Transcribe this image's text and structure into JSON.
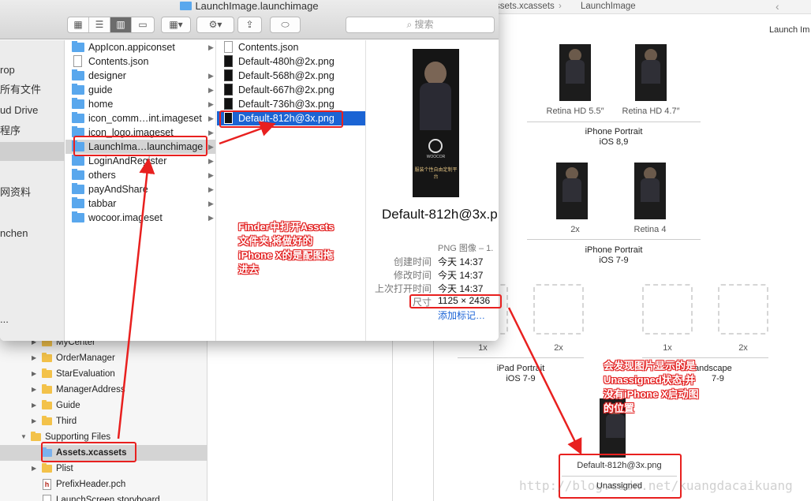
{
  "xcode": {
    "jump_bar": [
      "ssets.xcassets",
      "LaunchImage"
    ],
    "section_label": "Launch Im",
    "navigator_rows": [
      {
        "label": "MyCenter",
        "kind": "folder",
        "indent": 1,
        "open": false
      },
      {
        "label": "OrderManager",
        "kind": "folder",
        "indent": 1,
        "open": false
      },
      {
        "label": "StarEvaluation",
        "kind": "folder",
        "indent": 1,
        "open": false
      },
      {
        "label": "ManagerAddress",
        "kind": "folder",
        "indent": 1,
        "open": false
      },
      {
        "label": "Guide",
        "kind": "folder",
        "indent": 1,
        "open": false
      },
      {
        "label": "Third",
        "kind": "folder",
        "indent": 1,
        "open": false
      },
      {
        "label": "Supporting Files",
        "kind": "folder",
        "indent": 0,
        "open": true
      },
      {
        "label": "Assets.xcassets",
        "kind": "assets",
        "indent": 1,
        "open": false
      },
      {
        "label": "Plist",
        "kind": "folder",
        "indent": 1,
        "open": false
      },
      {
        "label": "PrefixHeader.pch",
        "kind": "header",
        "indent": 1,
        "open": false
      },
      {
        "label": "LaunchScreen.storyboard",
        "kind": "storyboard",
        "indent": 1,
        "open": false
      }
    ],
    "slots": {
      "retina55": "Retina HD 5.5″",
      "retina47": "Retina HD 4.7″",
      "iphone_portrait_89": [
        "iPhone Portrait",
        "iOS 8,9"
      ],
      "x2": "2x",
      "retina4": "Retina 4",
      "iphone_portrait_79": [
        "iPhone Portrait",
        "iOS 7-9"
      ],
      "x1": "1x",
      "ipad_portrait": [
        "iPad Portrait",
        "iOS 7-9"
      ],
      "ipad_landscape": [
        "andscape",
        "7-9"
      ],
      "unassigned_file": "Default-812h@3x.png",
      "unassigned_label": "Unassigned"
    }
  },
  "finder": {
    "title": "LaunchImage.launchimage",
    "search_placeholder": "搜索",
    "sidebar": [
      "rop",
      "所有文件",
      "ud Drive",
      "程序",
      "",
      "网资料",
      "",
      "nchen",
      "",
      "..."
    ],
    "col1": [
      {
        "name": "AppIcon.appiconset",
        "folder": true,
        "arrow": true
      },
      {
        "name": "Contents.json",
        "folder": false,
        "arrow": false
      },
      {
        "name": "designer",
        "folder": true,
        "arrow": true
      },
      {
        "name": "guide",
        "folder": true,
        "arrow": true
      },
      {
        "name": "home",
        "folder": true,
        "arrow": true
      },
      {
        "name": "icon_comm…int.imageset",
        "folder": true,
        "arrow": true
      },
      {
        "name": "icon_logo.imageset",
        "folder": true,
        "arrow": true
      },
      {
        "name": "LaunchIma…launchimage",
        "folder": true,
        "arrow": true,
        "selected": true
      },
      {
        "name": "LoginAndRegister",
        "folder": true,
        "arrow": true
      },
      {
        "name": "others",
        "folder": true,
        "arrow": true
      },
      {
        "name": "payAndShare",
        "folder": true,
        "arrow": true
      },
      {
        "name": "tabbar",
        "folder": true,
        "arrow": true
      },
      {
        "name": "wocoor.imageset",
        "folder": true,
        "arrow": true
      }
    ],
    "col2": [
      {
        "name": "Contents.json",
        "dark": false
      },
      {
        "name": "Default-480h@2x.png",
        "dark": true
      },
      {
        "name": "Default-568h@2x.png",
        "dark": true
      },
      {
        "name": "Default-667h@2x.png",
        "dark": true
      },
      {
        "name": "Default-736h@3x.png",
        "dark": true
      },
      {
        "name": "Default-812h@3x.png",
        "dark": true,
        "selected": true
      }
    ],
    "preview": {
      "filename": "Default-812h@3x.p",
      "brand": "WOOCOR",
      "slogan": "服装个性自由定制平台",
      "kind_label": "PNG 图像 – 1.",
      "created_k": "创建时间",
      "created_v": "今天 14:37",
      "modified_k": "修改时间",
      "modified_v": "今天 14:37",
      "opened_k": "上次打开时间",
      "opened_v": "今天 14:37",
      "size_k": "尺寸",
      "size_v": "1125 × 2436",
      "add_tags": "添加标记…"
    }
  },
  "annotations": {
    "note1": [
      "Finder中打开Assets",
      "文件夹,将做好的",
      "iPhone X的是配图拖",
      "进去"
    ],
    "note2": [
      "会发现图片显示的是",
      "Unassigned状态,并",
      "没有iPhone X启动图",
      "的位置"
    ]
  },
  "watermark": "http://blog.csdn.net/kuangdacaikuang"
}
